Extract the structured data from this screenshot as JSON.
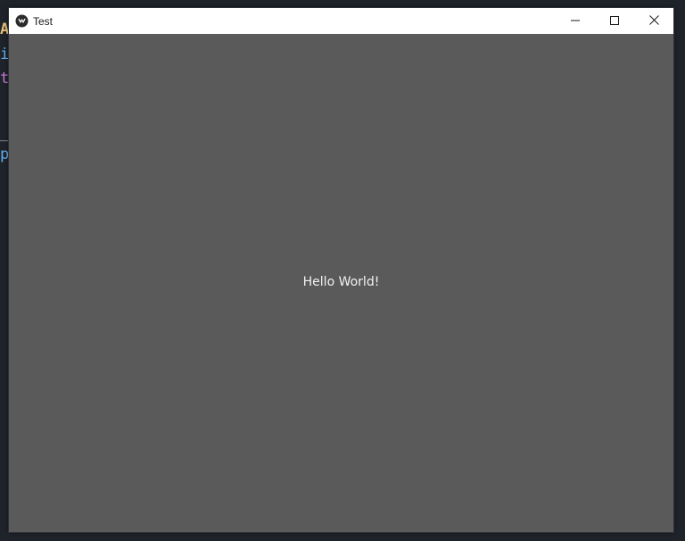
{
  "background_editor": {
    "glyphs": [
      "A",
      "i",
      "t",
      "_",
      "p"
    ]
  },
  "window": {
    "title": "Test",
    "app_icon": "kivy-logo-icon",
    "controls": {
      "minimize_icon": "minimize-icon",
      "maximize_icon": "maximize-icon",
      "close_icon": "close-icon"
    },
    "content": {
      "label": "Hello World!",
      "background_color": "#5a5a5a"
    }
  }
}
